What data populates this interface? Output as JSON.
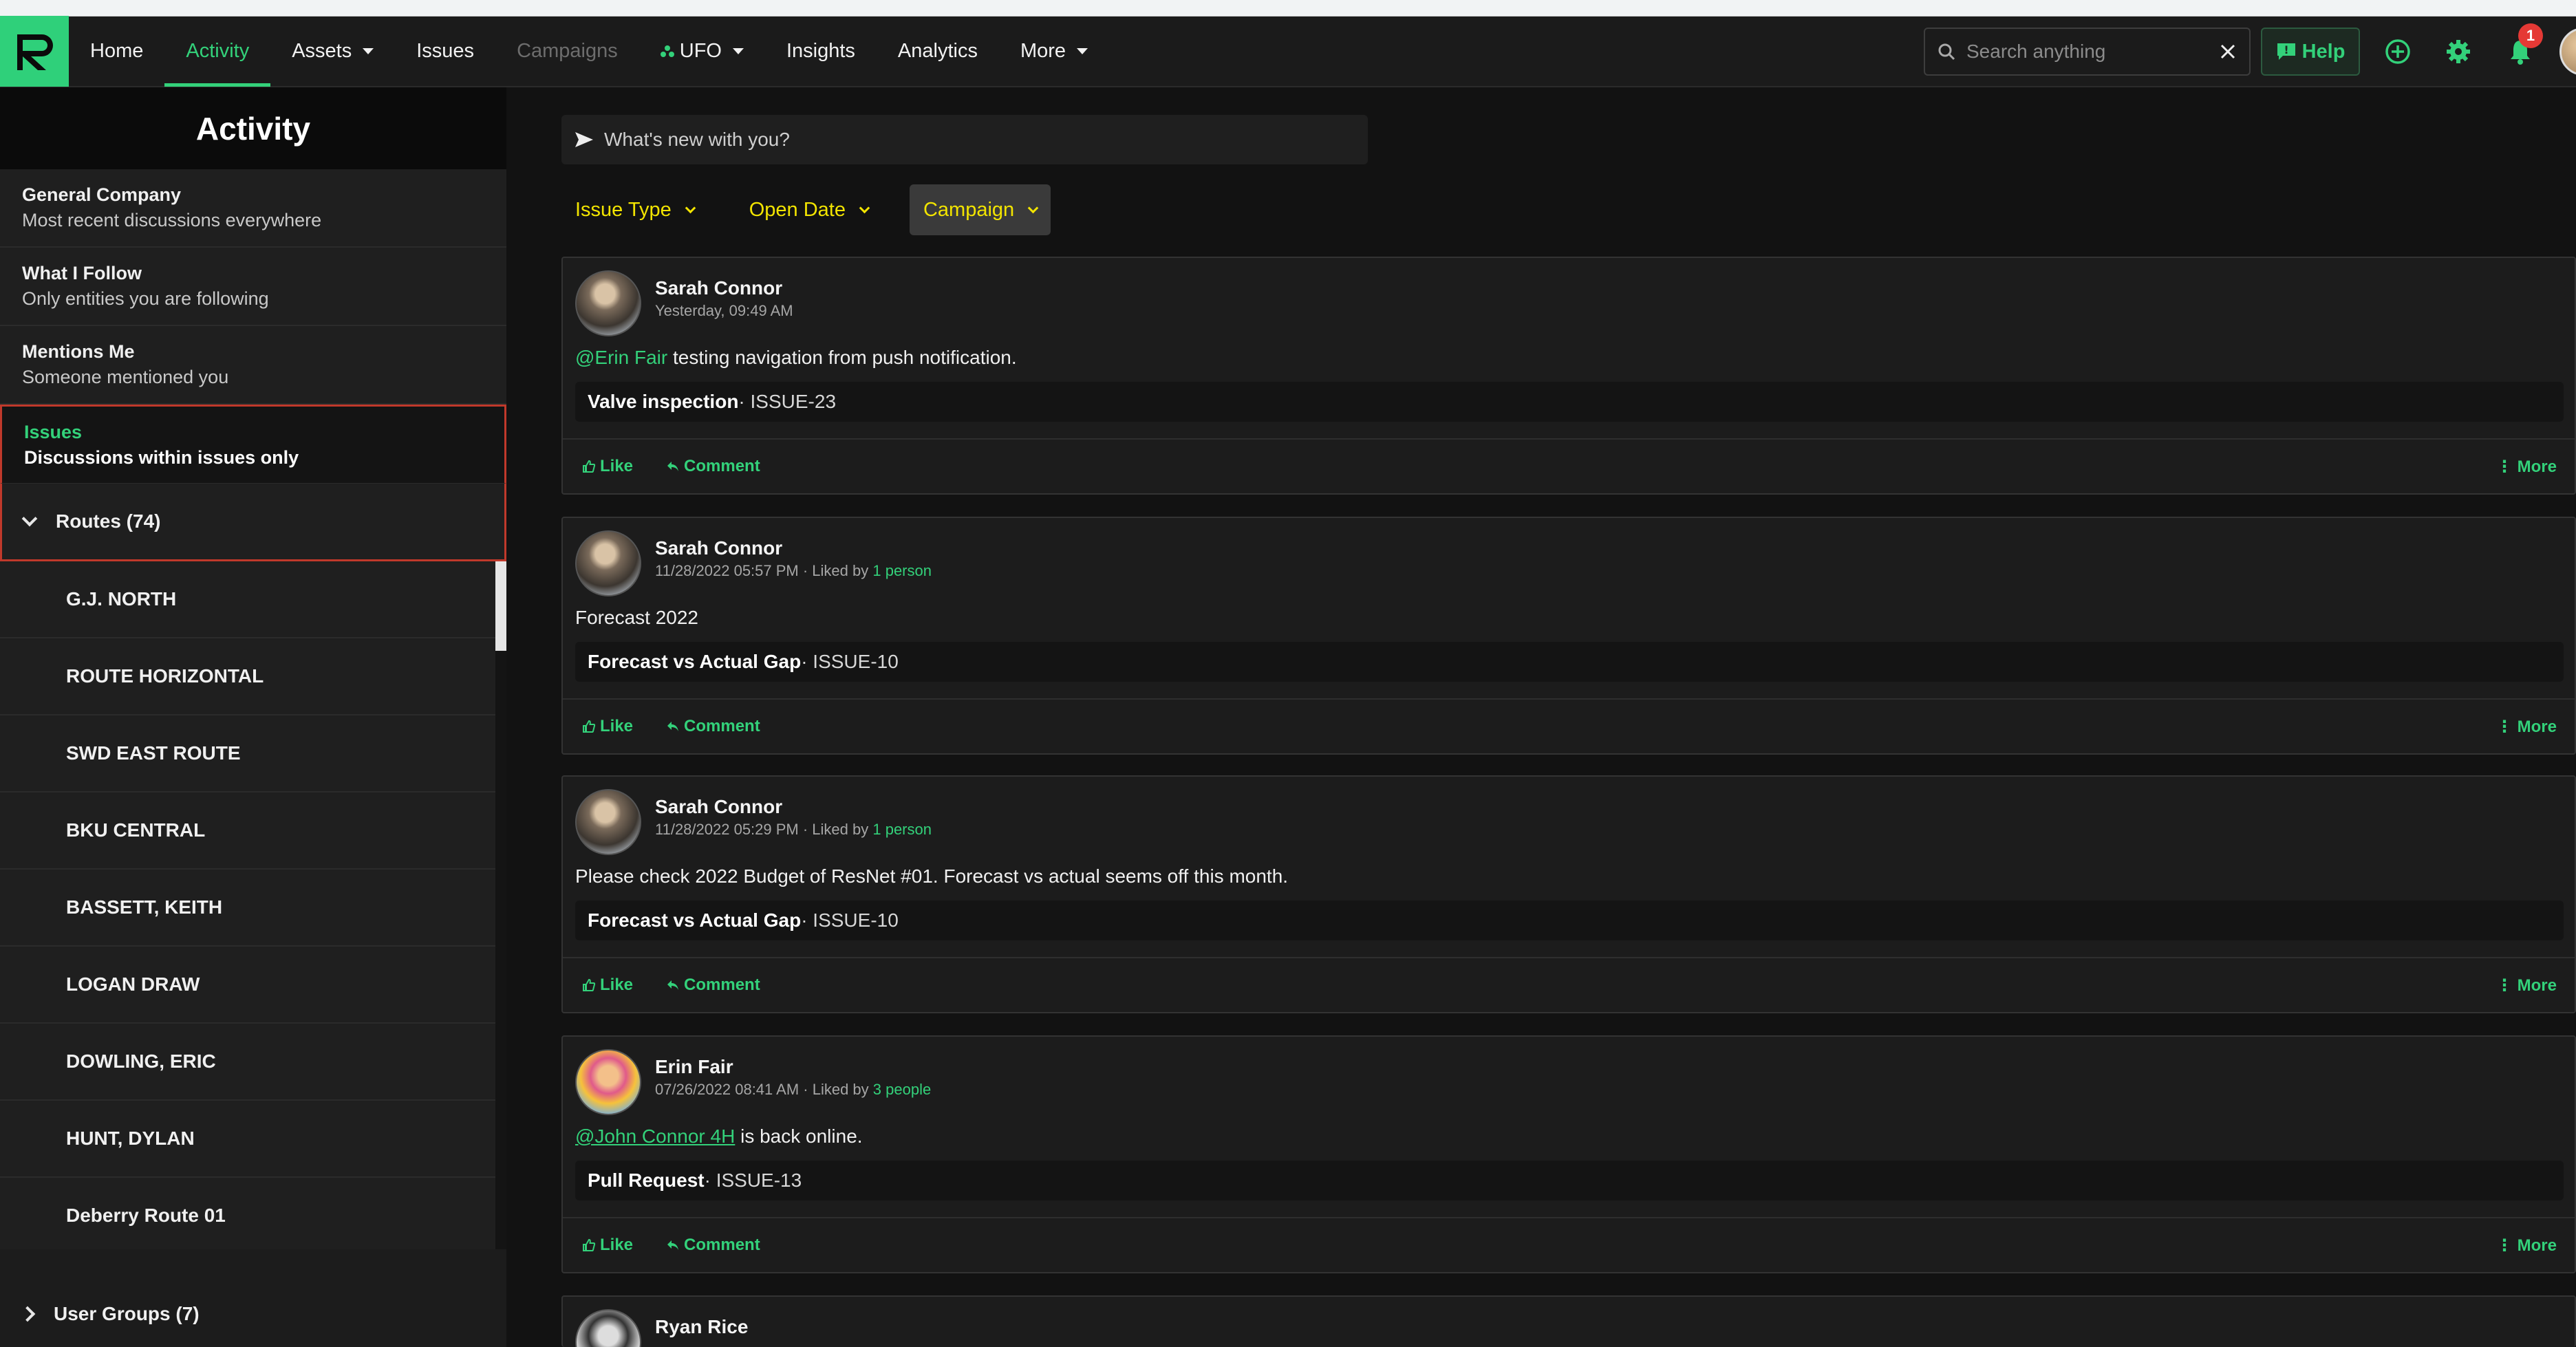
{
  "nav": {
    "items": [
      {
        "label": "Home"
      },
      {
        "label": "Activity"
      },
      {
        "label": "Assets"
      },
      {
        "label": "Issues"
      },
      {
        "label": "Campaigns"
      },
      {
        "label": "UFO"
      },
      {
        "label": "Insights"
      },
      {
        "label": "Analytics"
      },
      {
        "label": "More"
      }
    ],
    "search_placeholder": "Search anything",
    "help_label": "Help",
    "notification_count": "1"
  },
  "sidebar": {
    "title": "Activity",
    "items": [
      {
        "title": "General Company",
        "subtitle": "Most recent discussions everywhere"
      },
      {
        "title": "What I Follow",
        "subtitle": "Only entities you are following"
      },
      {
        "title": "Mentions Me",
        "subtitle": "Someone mentioned you"
      },
      {
        "title": "Issues",
        "subtitle": "Discussions within issues only"
      }
    ],
    "routes_label": "Routes (74)",
    "routes": [
      "G.J. NORTH",
      "ROUTE HORIZONTAL",
      "SWD EAST ROUTE",
      "BKU CENTRAL",
      "BASSETT, KEITH",
      "LOGAN DRAW",
      "DOWLING, ERIC",
      "HUNT, DYLAN",
      "Deberry Route 01"
    ],
    "user_groups_label": "User Groups (7)"
  },
  "compose": {
    "placeholder": "What's new with you?"
  },
  "filters": [
    {
      "label": "Issue Type"
    },
    {
      "label": "Open Date"
    },
    {
      "label": "Campaign"
    }
  ],
  "posts": [
    {
      "author": "Sarah Connor",
      "time": "Yesterday, 09:49 AM",
      "liked": "",
      "mention": "@Erin Fair",
      "text": " testing navigation from push notification.",
      "ref_title": "Valve inspection",
      "ref_id": " · ISSUE-23"
    },
    {
      "author": "Sarah Connor",
      "time": "11/28/2022 05:57 PM · Liked by ",
      "liked": "1 person",
      "mention": "",
      "text": "Forecast 2022",
      "ref_title": "Forecast vs Actual Gap",
      "ref_id": " · ISSUE-10"
    },
    {
      "author": "Sarah Connor",
      "time": "11/28/2022 05:29 PM · Liked by ",
      "liked": "1 person",
      "mention": "",
      "text": "Please check 2022 Budget of ResNet #01. Forecast vs actual seems off this month.",
      "ref_title": "Forecast vs Actual Gap",
      "ref_id": " · ISSUE-10"
    },
    {
      "author": "Erin Fair",
      "time": "07/26/2022 08:41 AM · Liked by ",
      "liked": "3 people",
      "mention": "@John Connor 4H",
      "text": " is back online.",
      "ref_title": "Pull Request",
      "ref_id": " · ISSUE-13"
    },
    {
      "author": "Ryan Rice"
    }
  ],
  "actions": {
    "like": "Like",
    "comment": "Comment",
    "more": "More"
  },
  "colors": {
    "accent": "#33d17a",
    "filter": "#f2e400",
    "active_border": "#c0392b"
  }
}
